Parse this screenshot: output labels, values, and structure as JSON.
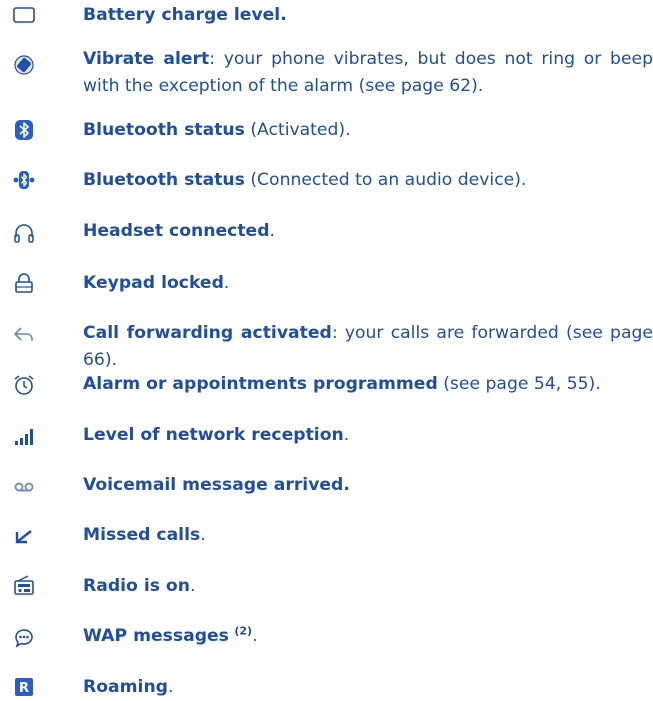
{
  "accent": "#1f4ea3",
  "items": [
    {
      "icon": "battery-icon",
      "bold": "Battery charge level.",
      "rest": ""
    },
    {
      "icon": "vibrate-icon",
      "bold": "Vibrate alert",
      "rest": ": your phone vibrates, but does not ring or beep with the exception of the alarm (see page 62)."
    },
    {
      "icon": "bluetooth-icon",
      "bold": "Bluetooth status",
      "rest": " (Activated)."
    },
    {
      "icon": "bluetooth-connected-icon",
      "bold": "Bluetooth status",
      "rest": " (Connected to an audio device)."
    },
    {
      "icon": "headset-icon",
      "bold": "Headset connected",
      "rest": "."
    },
    {
      "icon": "lock-icon",
      "bold": "Keypad locked",
      "rest": "."
    },
    {
      "icon": "call-forward-icon",
      "bold": "Call forwarding activated",
      "rest": ": your calls are forwarded (see page 66)."
    },
    {
      "icon": "alarm-icon",
      "bold": "Alarm or appointments programmed",
      "rest": " (see page 54, 55)."
    },
    {
      "icon": "signal-icon",
      "bold": "Level of network reception",
      "rest": "."
    },
    {
      "icon": "voicemail-icon",
      "bold": "Voicemail message arrived.",
      "rest": ""
    },
    {
      "icon": "missed-call-icon",
      "bold": "Missed calls",
      "rest": "."
    },
    {
      "icon": "radio-icon",
      "bold": "Radio is on",
      "rest": "."
    },
    {
      "icon": "wap-icon",
      "bold": "WAP messages",
      "sup": "(2)",
      "rest": "."
    },
    {
      "icon": "roaming-icon",
      "bold": "Roaming",
      "rest": "."
    }
  ]
}
